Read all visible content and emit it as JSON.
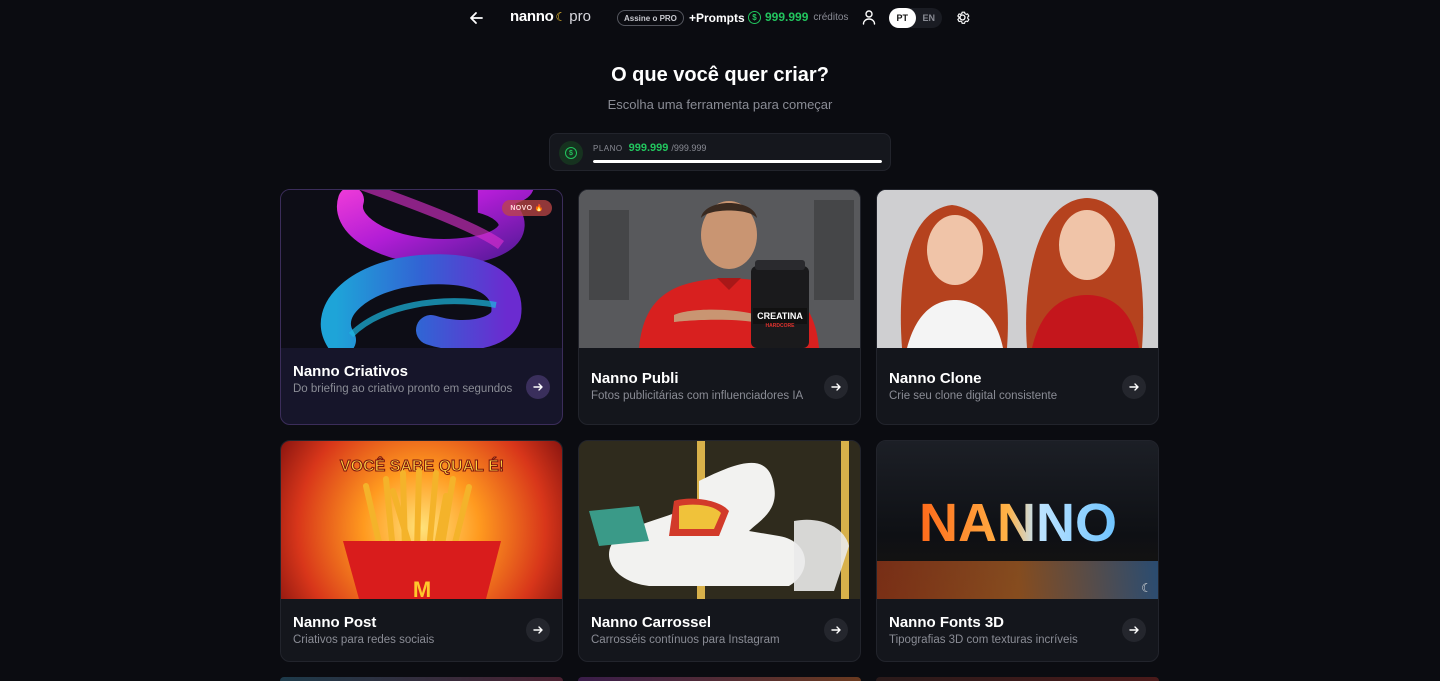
{
  "header": {
    "logo_bold": "nanno",
    "logo_light": "pro",
    "pro_badge": "Assine o PRO",
    "prompts_label": "+Prompts",
    "credits_symbol": "$",
    "credits_amount": "999.999",
    "credits_label": "créditos",
    "lang_active": "PT",
    "lang_inactive": "EN"
  },
  "hero": {
    "title": "O que você quer criar?",
    "subtitle": "Escolha uma ferramenta para começar"
  },
  "plan": {
    "label": "PLANO",
    "value": "999.999",
    "max": "/999.999",
    "progress_fraction": 1.0
  },
  "cards": [
    {
      "title": "Nanno Criativos",
      "desc": "Do briefing ao criativo pronto em segundos",
      "badge": "NOVO 🔥"
    },
    {
      "title": "Nanno Publi",
      "desc": "Fotos publicitárias com influenciadores IA"
    },
    {
      "title": "Nanno Clone",
      "desc": "Crie seu clone digital consistente"
    },
    {
      "title": "Nanno Post",
      "desc": "Criativos para redes sociais"
    },
    {
      "title": "Nanno Carrossel",
      "desc": "Carrosséis contínuos para Instagram"
    },
    {
      "title": "Nanno Fonts 3D",
      "desc": "Tipografias 3D com texturas incríveis"
    }
  ],
  "images": {
    "publi_product_text": "CREATINA",
    "publi_product_sub": "HARDCORE",
    "post_headline": "VOCÊ SABE QUAL É!",
    "fonts3d_text": "NANNO"
  },
  "colors": {
    "accent_green": "#22c55e",
    "background": "#0b0c11",
    "card_bg": "#14161c"
  },
  "icons": [
    "arrow-left-icon",
    "banana-icon",
    "coin-icon",
    "user-icon",
    "gear-icon",
    "arrow-right-icon"
  ]
}
